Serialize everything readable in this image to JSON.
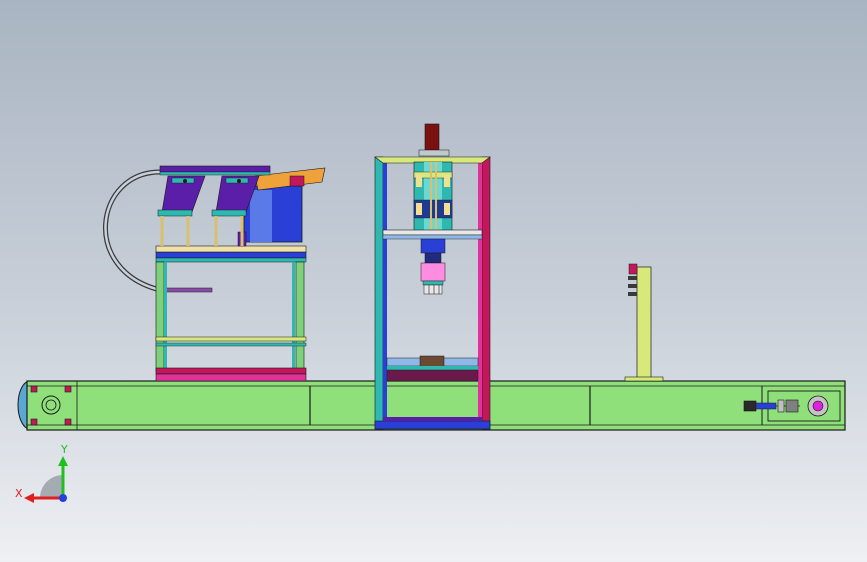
{
  "viewport": {
    "background_top": "#a9b4c2",
    "background_bottom": "#eef0f3"
  },
  "colors": {
    "conveyor_green": "#8fe07a",
    "outline": "#1a1a1a",
    "accent_magenta": "#c2185b",
    "accent_purple": "#5a1ea8",
    "accent_blue": "#2a3fd6",
    "accent_teal": "#2fb8b0",
    "accent_yellow": "#d8e87a",
    "accent_orange": "#f0a23a",
    "accent_pink": "#ff8ce0"
  },
  "triad": {
    "x_label": "X",
    "y_label": "Y",
    "x_color": "#e02020",
    "y_color": "#1fbf1f",
    "z_color": "#2040e0"
  }
}
